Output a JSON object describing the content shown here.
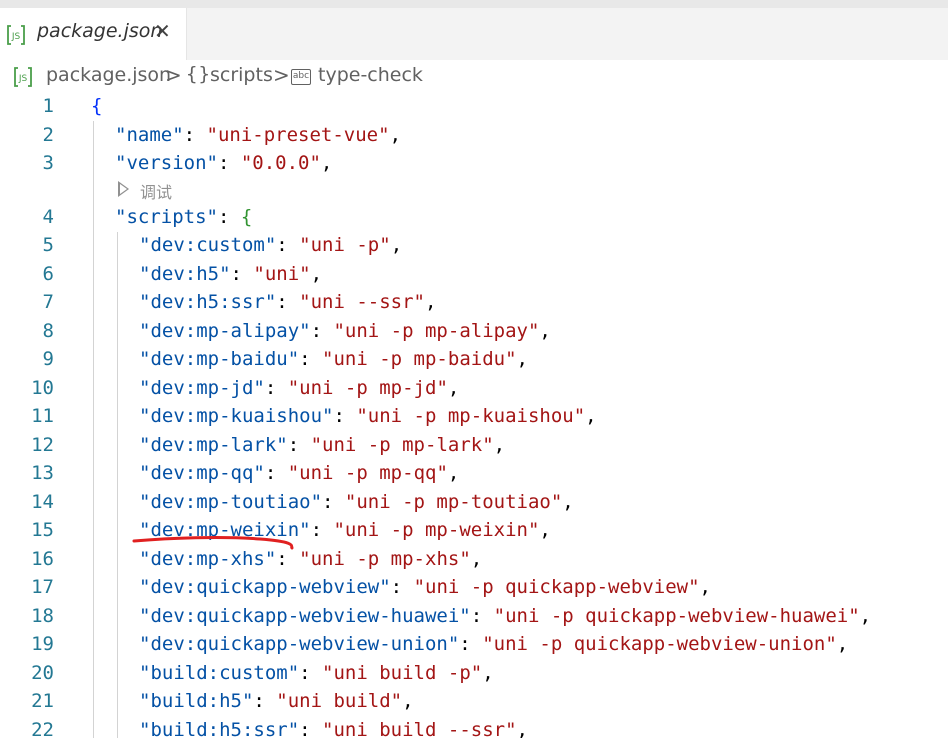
{
  "tab": {
    "title": "package.json",
    "close_glyph": "✕",
    "icon": "js-file-icon"
  },
  "breadcrumb": {
    "file": "package.json",
    "section_icon": "braces-icon",
    "section": "scripts",
    "item_icon": "string-abc-icon",
    "item": "type-check",
    "separator": ">"
  },
  "codelens": {
    "label": "调试"
  },
  "colors": {
    "key": "#0451a5",
    "string": "#a31515",
    "line_number": "#237893",
    "brace1": "#0431fa",
    "brace2": "#319331",
    "annotation": "#e02020"
  },
  "lines": [
    {
      "n": "1",
      "key": "",
      "value": "",
      "text": "{"
    },
    {
      "n": "2",
      "key": "\"name\"",
      "value": "\"uni-preset-vue\"",
      "text": ","
    },
    {
      "n": "3",
      "key": "\"version\"",
      "value": "\"0.0.0\"",
      "text": ","
    },
    {
      "n": "4",
      "key": "\"scripts\"",
      "value": "",
      "text": "{"
    },
    {
      "n": "5",
      "key": "\"dev:custom\"",
      "value": "\"uni -p\"",
      "text": ","
    },
    {
      "n": "6",
      "key": "\"dev:h5\"",
      "value": "\"uni\"",
      "text": ","
    },
    {
      "n": "7",
      "key": "\"dev:h5:ssr\"",
      "value": "\"uni --ssr\"",
      "text": ","
    },
    {
      "n": "8",
      "key": "\"dev:mp-alipay\"",
      "value": "\"uni -p mp-alipay\"",
      "text": ","
    },
    {
      "n": "9",
      "key": "\"dev:mp-baidu\"",
      "value": "\"uni -p mp-baidu\"",
      "text": ","
    },
    {
      "n": "10",
      "key": "\"dev:mp-jd\"",
      "value": "\"uni -p mp-jd\"",
      "text": ","
    },
    {
      "n": "11",
      "key": "\"dev:mp-kuaishou\"",
      "value": "\"uni -p mp-kuaishou\"",
      "text": ","
    },
    {
      "n": "12",
      "key": "\"dev:mp-lark\"",
      "value": "\"uni -p mp-lark\"",
      "text": ","
    },
    {
      "n": "13",
      "key": "\"dev:mp-qq\"",
      "value": "\"uni -p mp-qq\"",
      "text": ","
    },
    {
      "n": "14",
      "key": "\"dev:mp-toutiao\"",
      "value": "\"uni -p mp-toutiao\"",
      "text": ","
    },
    {
      "n": "15",
      "key": "\"dev:mp-weixin\"",
      "value": "\"uni -p mp-weixin\"",
      "text": ","
    },
    {
      "n": "16",
      "key": "\"dev:mp-xhs\"",
      "value": "\"uni -p mp-xhs\"",
      "text": ","
    },
    {
      "n": "17",
      "key": "\"dev:quickapp-webview\"",
      "value": "\"uni -p quickapp-webview\"",
      "text": ","
    },
    {
      "n": "18",
      "key": "\"dev:quickapp-webview-huawei\"",
      "value": "\"uni -p quickapp-webview-huawei\"",
      "text": ","
    },
    {
      "n": "19",
      "key": "\"dev:quickapp-webview-union\"",
      "value": "\"uni -p quickapp-webview-union\"",
      "text": ","
    },
    {
      "n": "20",
      "key": "\"build:custom\"",
      "value": "\"uni build -p\"",
      "text": ","
    },
    {
      "n": "21",
      "key": "\"build:h5\"",
      "value": "\"uni build\"",
      "text": ","
    },
    {
      "n": "22",
      "key": "\"build:h5:ssr\"",
      "value": "\"uni build --ssr\"",
      "text": ","
    }
  ]
}
